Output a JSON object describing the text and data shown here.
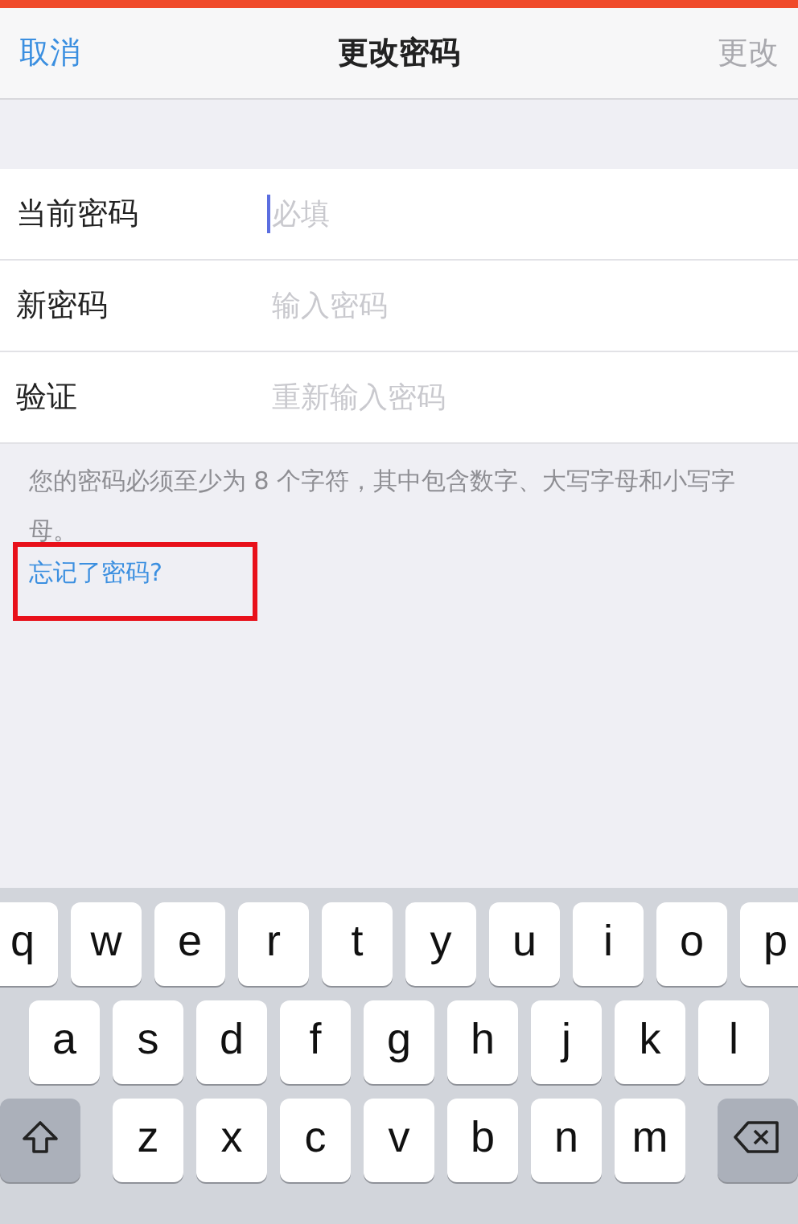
{
  "nav": {
    "cancel": "取消",
    "title": "更改密码",
    "done": {
      "label": "更改",
      "disabled": true
    }
  },
  "fields": [
    {
      "label": "当前密码",
      "placeholder": "必填",
      "focused": true
    },
    {
      "label": "新密码",
      "placeholder": "输入密码",
      "focused": false
    },
    {
      "label": "验证",
      "placeholder": "重新输入密码",
      "focused": false
    }
  ],
  "hint": "您的密码必须至少为 8 个字符，其中包含数字、大写字母和小写字母。",
  "forgot_link": "忘记了密码?",
  "highlight_box": true,
  "keyboard": {
    "rows": [
      [
        "q",
        "w",
        "e",
        "r",
        "t",
        "y",
        "u",
        "i",
        "o",
        "p"
      ],
      [
        "a",
        "s",
        "d",
        "f",
        "g",
        "h",
        "j",
        "k",
        "l"
      ],
      [
        "z",
        "x",
        "c",
        "v",
        "b",
        "n",
        "m"
      ]
    ]
  }
}
